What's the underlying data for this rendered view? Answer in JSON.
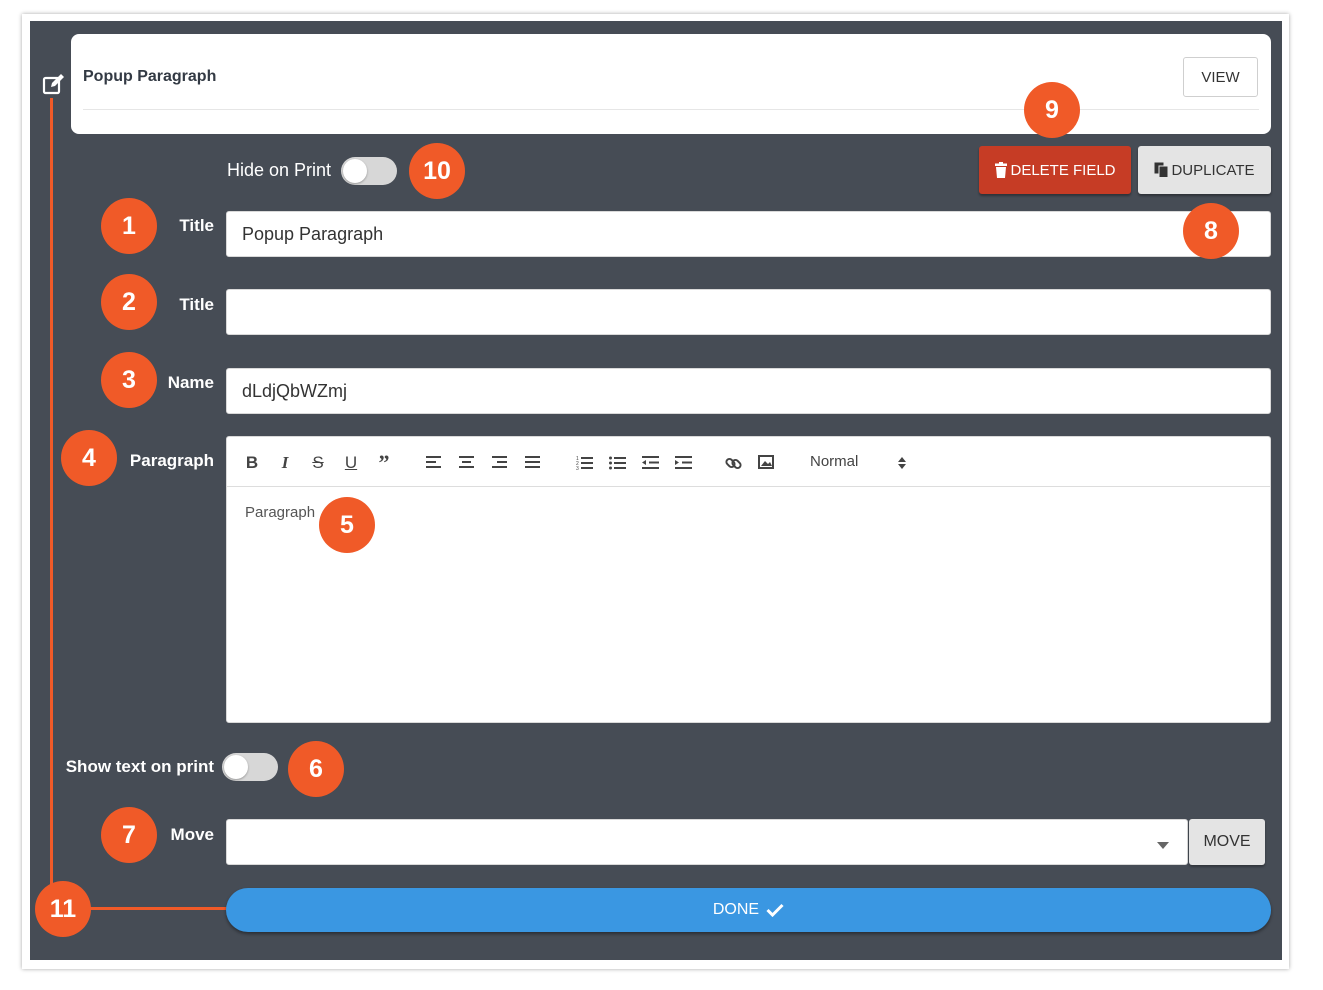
{
  "header": {
    "title": "Popup Paragraph",
    "view_label": "VIEW"
  },
  "hide_on_print": {
    "label": "Hide on Print",
    "on": false
  },
  "actions": {
    "delete_label": "DELETE FIELD",
    "duplicate_label": "DUPLICATE"
  },
  "fields": [
    {
      "label": "Title",
      "value": "Popup Paragraph"
    },
    {
      "label": "Title",
      "value": ""
    },
    {
      "label": "Name",
      "value": "dLdjQbWZmj"
    }
  ],
  "paragraph": {
    "label": "Paragraph",
    "text": "Paragraph",
    "format": "Normal",
    "toolbar": [
      "bold-icon",
      "italic-icon",
      "strikethrough-icon",
      "underline-icon",
      "blockquote-icon",
      "align-left-icon",
      "align-center-icon",
      "align-right-icon",
      "align-justify-icon",
      "ordered-list-icon",
      "bullet-list-icon",
      "outdent-icon",
      "indent-icon",
      "link-icon",
      "image-icon"
    ]
  },
  "show_text_on_print": {
    "label": "Show text on print",
    "on": false
  },
  "move": {
    "label": "Move",
    "value": "",
    "button_label": "MOVE"
  },
  "done": {
    "label": "DONE"
  },
  "badges": [
    "1",
    "2",
    "3",
    "4",
    "5",
    "6",
    "7",
    "8",
    "9",
    "10",
    "11"
  ],
  "colors": {
    "panel": "#464c55",
    "accent": "#f05a28",
    "delete": "#c63c25",
    "done": "#3a97e2"
  }
}
